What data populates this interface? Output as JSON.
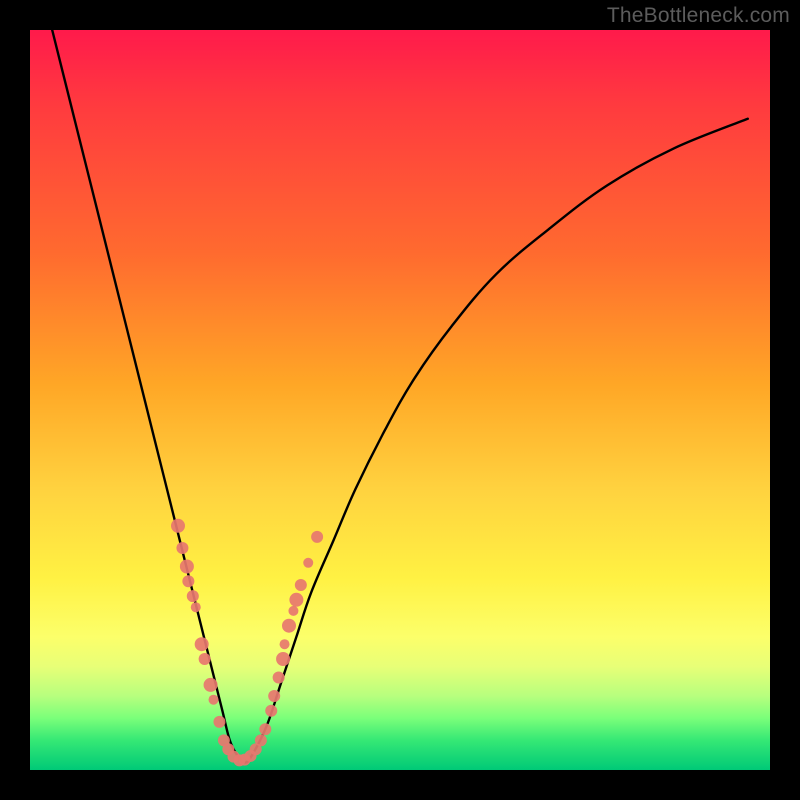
{
  "watermark": "TheBottleneck.com",
  "chart_data": {
    "type": "line",
    "title": "",
    "xlabel": "",
    "ylabel": "",
    "xlim": [
      0,
      100
    ],
    "ylim": [
      0,
      100
    ],
    "series": [
      {
        "name": "bottleneck-curve",
        "x": [
          3,
          5,
          7,
          9,
          11,
          13,
          15,
          17,
          19,
          21,
          22,
          23,
          24,
          25,
          26,
          27,
          28,
          29,
          30,
          32,
          34,
          36,
          38,
          41,
          44,
          48,
          52,
          57,
          63,
          70,
          78,
          87,
          97
        ],
        "y": [
          100,
          92,
          84,
          76,
          68,
          60,
          52,
          44,
          36,
          28,
          24,
          20,
          16,
          12,
          8,
          4,
          2,
          1,
          2,
          6,
          12,
          18,
          24,
          31,
          38,
          46,
          53,
          60,
          67,
          73,
          79,
          84,
          88
        ]
      }
    ],
    "scatter_points": {
      "name": "observations",
      "color": "#e7776f",
      "points": [
        {
          "x": 20.0,
          "y": 33.0,
          "r": 7
        },
        {
          "x": 20.6,
          "y": 30.0,
          "r": 6
        },
        {
          "x": 21.2,
          "y": 27.5,
          "r": 7
        },
        {
          "x": 21.4,
          "y": 25.5,
          "r": 6
        },
        {
          "x": 22.0,
          "y": 23.5,
          "r": 6
        },
        {
          "x": 22.4,
          "y": 22.0,
          "r": 5
        },
        {
          "x": 23.2,
          "y": 17.0,
          "r": 7
        },
        {
          "x": 23.6,
          "y": 15.0,
          "r": 6
        },
        {
          "x": 24.4,
          "y": 11.5,
          "r": 7
        },
        {
          "x": 24.8,
          "y": 9.5,
          "r": 5
        },
        {
          "x": 25.6,
          "y": 6.5,
          "r": 6
        },
        {
          "x": 26.2,
          "y": 4.0,
          "r": 6
        },
        {
          "x": 26.8,
          "y": 2.8,
          "r": 6
        },
        {
          "x": 27.5,
          "y": 1.8,
          "r": 6
        },
        {
          "x": 28.3,
          "y": 1.3,
          "r": 6
        },
        {
          "x": 29.0,
          "y": 1.4,
          "r": 6
        },
        {
          "x": 29.8,
          "y": 1.9,
          "r": 6
        },
        {
          "x": 30.5,
          "y": 2.8,
          "r": 6
        },
        {
          "x": 31.2,
          "y": 4.0,
          "r": 6
        },
        {
          "x": 31.8,
          "y": 5.5,
          "r": 6
        },
        {
          "x": 32.6,
          "y": 8.0,
          "r": 6
        },
        {
          "x": 33.0,
          "y": 10.0,
          "r": 6
        },
        {
          "x": 33.6,
          "y": 12.5,
          "r": 6
        },
        {
          "x": 34.2,
          "y": 15.0,
          "r": 7
        },
        {
          "x": 34.4,
          "y": 17.0,
          "r": 5
        },
        {
          "x": 35.0,
          "y": 19.5,
          "r": 7
        },
        {
          "x": 35.6,
          "y": 21.5,
          "r": 5
        },
        {
          "x": 36.0,
          "y": 23.0,
          "r": 7
        },
        {
          "x": 36.6,
          "y": 25.0,
          "r": 6
        },
        {
          "x": 37.6,
          "y": 28.0,
          "r": 5
        },
        {
          "x": 38.8,
          "y": 31.5,
          "r": 6
        }
      ]
    }
  }
}
